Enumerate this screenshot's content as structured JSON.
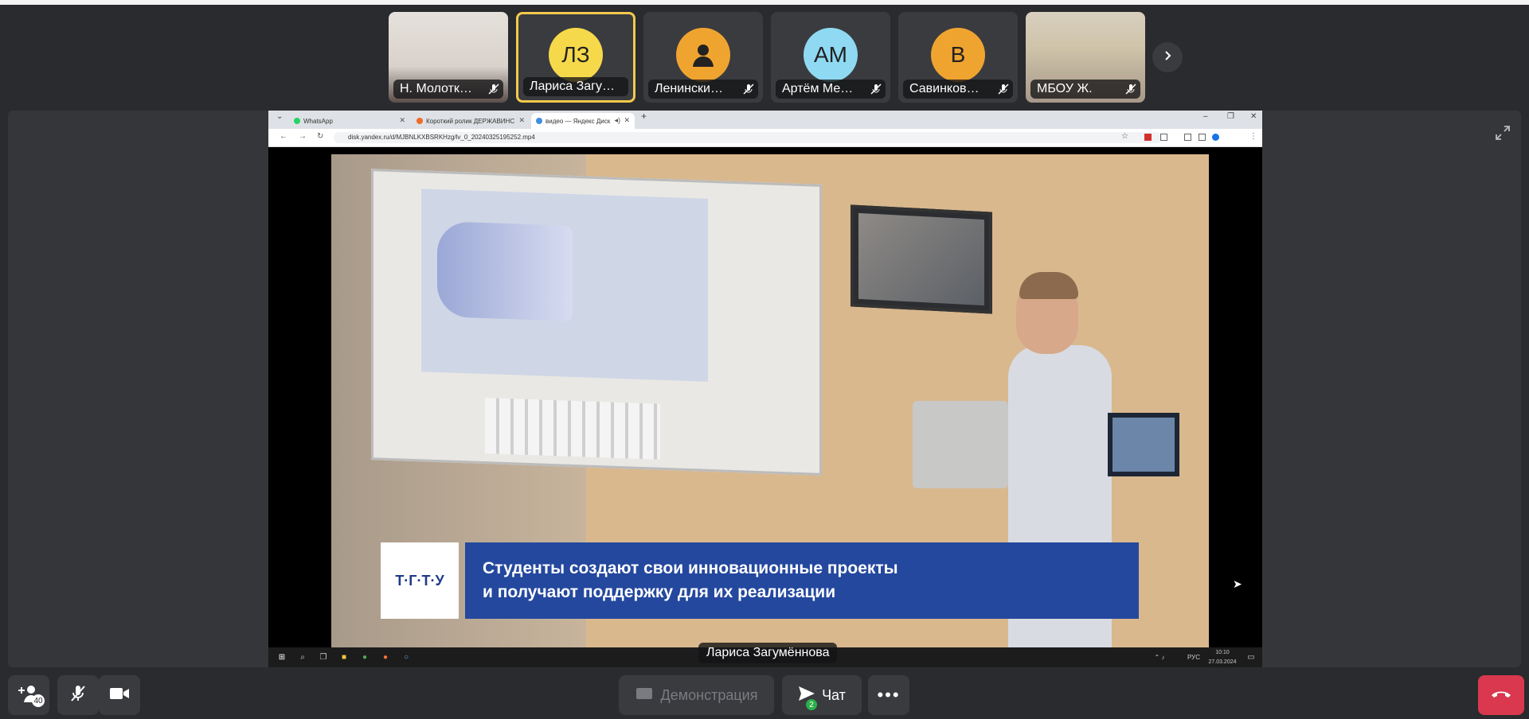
{
  "participants": [
    {
      "name": "Н. Молотк…",
      "has_video": true,
      "mic": "off"
    },
    {
      "name": "Лариса Загу…",
      "initials": "ЛЗ",
      "color": "#f5d94a",
      "active": true
    },
    {
      "name": "Ленински…",
      "icon": "person-icon",
      "color": "#f0a430",
      "mic": "off"
    },
    {
      "name": "Артём Ме…",
      "initials": "АМ",
      "color": "#8fd9f2",
      "mic": "off"
    },
    {
      "name": "Савинков…",
      "initials": "В",
      "color": "#f0a430",
      "mic": "off"
    },
    {
      "name": "МБОУ Ж.",
      "has_video": true,
      "mic": "off"
    }
  ],
  "browser": {
    "tabs": [
      "WhatsApp",
      "Короткий ролик ДЕРЖАВИНС",
      "видео — Яндекс Диск"
    ],
    "url": "disk.yandex.ru/d/MJBNLKXBSRKHzg/lv_0_20240325195252.mp4"
  },
  "video": {
    "logo_text": "Т·Г·Т·У",
    "caption_line1": "Студенты создают свои инновационные проекты",
    "caption_line2": "и получают поддержку для их реализации"
  },
  "taskbar": {
    "lang": "РУС",
    "time": "10:10",
    "date": "27.03.2024"
  },
  "speaker_name": "Лариса Загумённова",
  "controls": {
    "invite_count": "40",
    "demo_label": "Демонстрация",
    "chat_label": "Чат",
    "chat_badge": "2"
  },
  "colors": {
    "accent": "#f2c94c",
    "hangup": "#d9384f",
    "caption_bg": "#24489e"
  }
}
